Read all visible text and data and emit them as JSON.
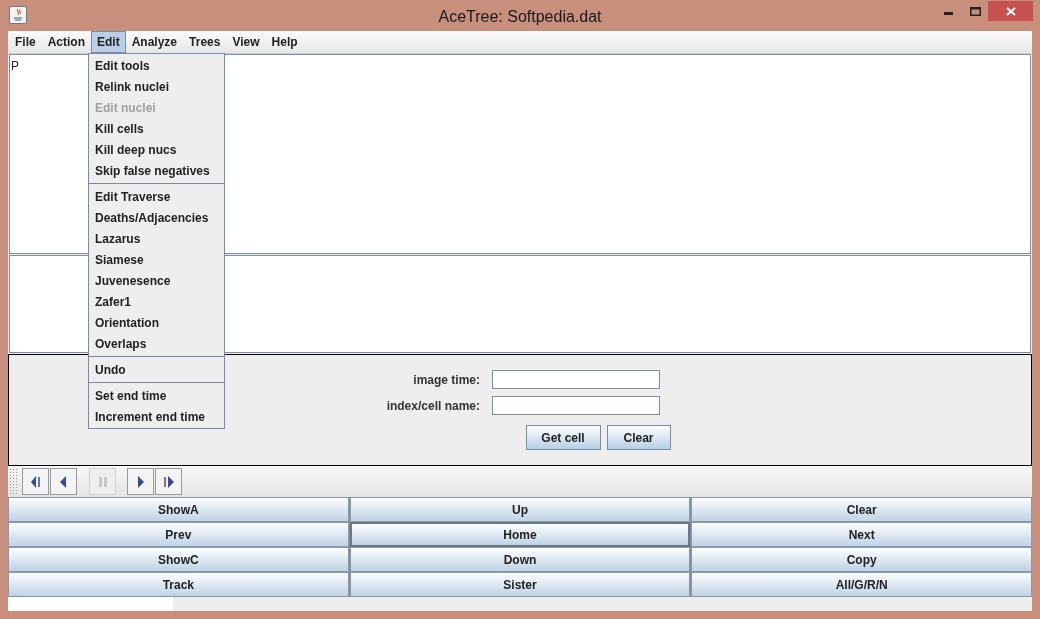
{
  "window": {
    "title": "AceTree: Softpedia.dat"
  },
  "menubar": [
    {
      "label": "File",
      "selected": false
    },
    {
      "label": "Action",
      "selected": false
    },
    {
      "label": "Edit",
      "selected": true
    },
    {
      "label": "Analyze",
      "selected": false
    },
    {
      "label": "Trees",
      "selected": false
    },
    {
      "label": "View",
      "selected": false
    },
    {
      "label": "Help",
      "selected": false
    }
  ],
  "edit_menu": [
    [
      {
        "label": "Edit tools",
        "disabled": false
      },
      {
        "label": "Relink nuclei",
        "disabled": false
      },
      {
        "label": "Edit nuclei",
        "disabled": true
      },
      {
        "label": "Kill cells",
        "disabled": false
      },
      {
        "label": "Kill deep nucs",
        "disabled": false
      },
      {
        "label": "Skip false negatives",
        "disabled": false
      }
    ],
    [
      {
        "label": "Edit Traverse",
        "disabled": false
      },
      {
        "label": "Deaths/Adjacencies",
        "disabled": false
      },
      {
        "label": "Lazarus",
        "disabled": false
      },
      {
        "label": "Siamese",
        "disabled": false
      },
      {
        "label": "Juvenesence",
        "disabled": false
      },
      {
        "label": "Zafer1",
        "disabled": false
      },
      {
        "label": "Orientation",
        "disabled": false
      },
      {
        "label": "Overlaps",
        "disabled": false
      }
    ],
    [
      {
        "label": "Undo",
        "disabled": false
      }
    ],
    [
      {
        "label": "Set end time",
        "disabled": false
      },
      {
        "label": "Increment end time",
        "disabled": false
      }
    ]
  ],
  "tree": {
    "root": "P"
  },
  "form": {
    "fields": [
      {
        "label": "image time:"
      },
      {
        "label": "index/cell name:"
      }
    ],
    "buttons": [
      "Get cell",
      "Clear"
    ]
  },
  "playback": [
    {
      "kind": "step-back",
      "disabled": false
    },
    {
      "kind": "back",
      "disabled": false
    },
    {
      "kind": "pause",
      "disabled": true
    },
    {
      "kind": "forward",
      "disabled": false
    },
    {
      "kind": "step-forward",
      "disabled": false
    }
  ],
  "buttons": [
    {
      "label": "ShowA",
      "selected": false
    },
    {
      "label": "Up",
      "selected": false
    },
    {
      "label": "Clear",
      "selected": false
    },
    {
      "label": "Prev",
      "selected": false
    },
    {
      "label": "Home",
      "selected": true
    },
    {
      "label": "Next",
      "selected": false
    },
    {
      "label": "ShowC",
      "selected": false
    },
    {
      "label": "Down",
      "selected": false
    },
    {
      "label": "Copy",
      "selected": false
    },
    {
      "label": "Track",
      "selected": false
    },
    {
      "label": "Sister",
      "selected": false
    },
    {
      "label": "All/G/R/N",
      "selected": false
    }
  ]
}
